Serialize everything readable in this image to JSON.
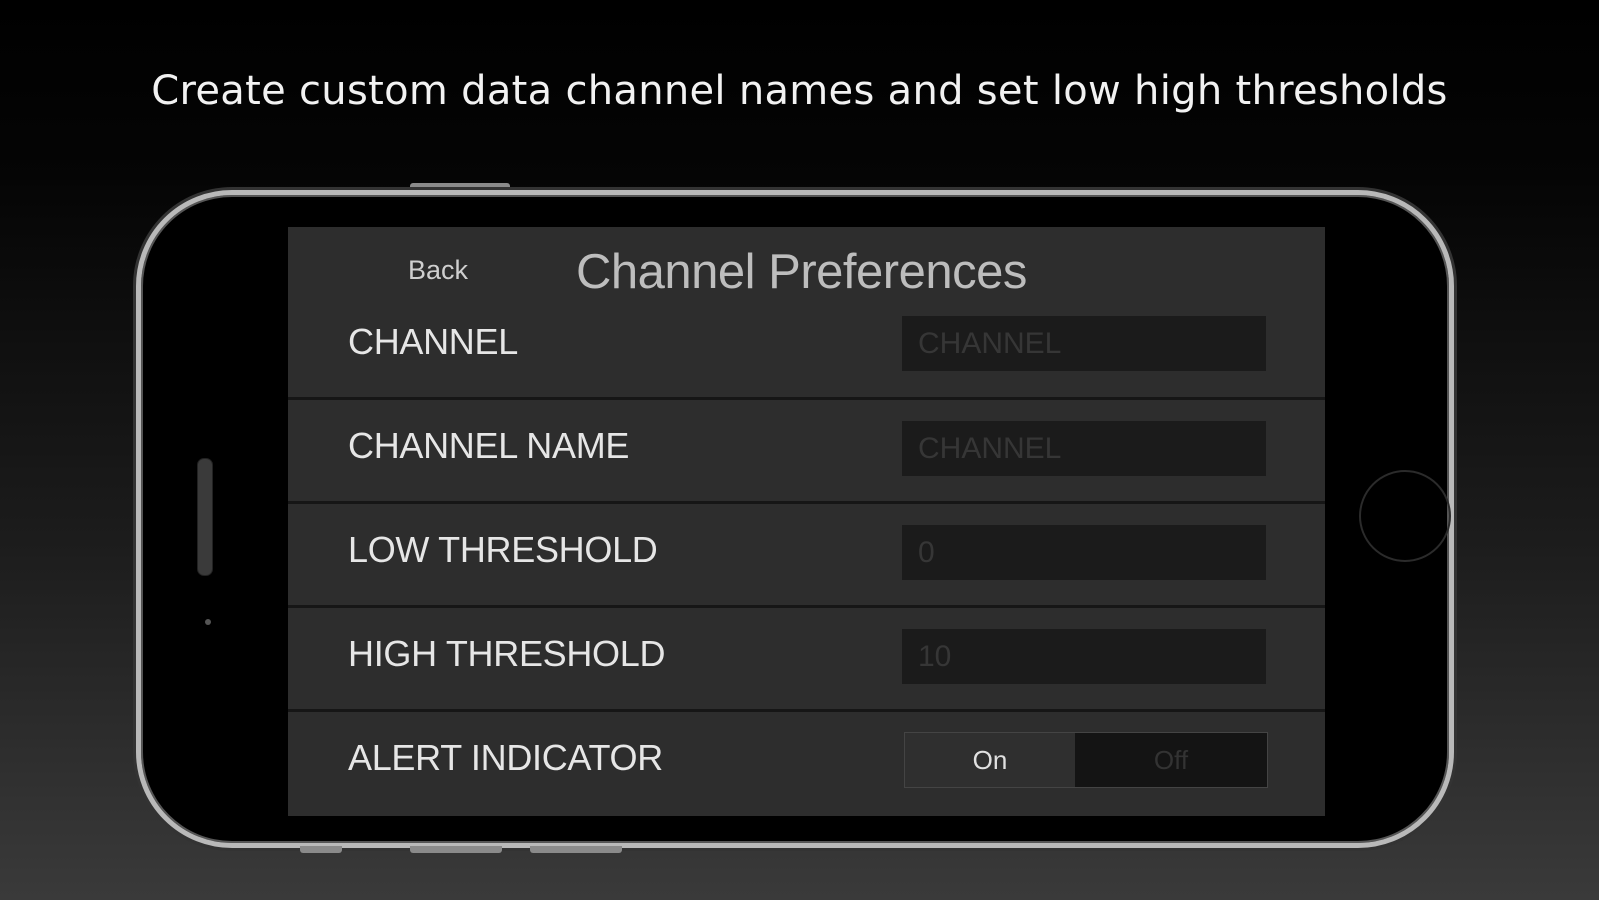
{
  "headline": "Create custom data channel names and set low high thresholds",
  "navbar": {
    "back_label": "Back",
    "title": "Channel Preferences"
  },
  "rows": [
    {
      "label": "CHANNEL",
      "placeholder": "CHANNEL"
    },
    {
      "label": "CHANNEL NAME",
      "placeholder": "CHANNEL"
    },
    {
      "label": "LOW THRESHOLD",
      "placeholder": "0"
    },
    {
      "label": "HIGH THRESHOLD",
      "placeholder": "10"
    }
  ],
  "alert": {
    "label": "ALERT INDICATOR",
    "on_label": "On",
    "off_label": "Off",
    "selected": "On"
  },
  "colors": {
    "background": "#000000",
    "panel": "#2d2d2d",
    "field": "#1b1b1b",
    "text": "#e6e6e6"
  }
}
